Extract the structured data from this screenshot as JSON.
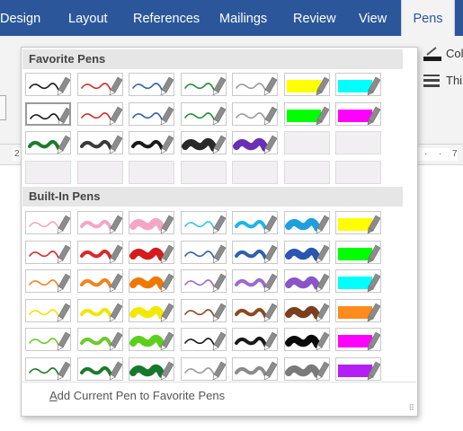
{
  "tabs": [
    {
      "label": "Design",
      "active": false
    },
    {
      "label": "Layout",
      "active": false
    },
    {
      "label": "References",
      "active": false
    },
    {
      "label": "Mailings",
      "active": false
    },
    {
      "label": "Review",
      "active": false
    },
    {
      "label": "View",
      "active": false
    },
    {
      "label": "Pens",
      "active": true
    }
  ],
  "ribbon": {
    "color_label": "Col",
    "thickness_label": "Thi"
  },
  "ruler": {
    "left_number": "2",
    "right_number": "7"
  },
  "gallery": {
    "favorite_header": "Favorite Pens",
    "builtin_header": "Built-In Pens",
    "add_link_prefix": "A",
    "add_link_rest": "dd Current Pen to Favorite Pens",
    "favorite_pens": [
      {
        "type": "pen",
        "color": "#1a1a1a",
        "width": 1.6
      },
      {
        "type": "pen",
        "color": "#d62b2b",
        "width": 1.6
      },
      {
        "type": "pen",
        "color": "#2f5fae",
        "width": 1.6
      },
      {
        "type": "pen",
        "color": "#238a3e",
        "width": 1.6
      },
      {
        "type": "pen",
        "color": "#9a9a9a",
        "width": 1.6
      },
      {
        "type": "highlighter",
        "color": "#ffff00"
      },
      {
        "type": "highlighter",
        "color": "#00ffff"
      },
      {
        "type": "pen",
        "color": "#1a1a1a",
        "width": 1.6,
        "selected": true
      },
      {
        "type": "pen",
        "color": "#d62b2b",
        "width": 1.6
      },
      {
        "type": "pen",
        "color": "#2f5fae",
        "width": 1.6
      },
      {
        "type": "pen",
        "color": "#238a3e",
        "width": 1.6
      },
      {
        "type": "pen",
        "color": "#9a9a9a",
        "width": 1.6
      },
      {
        "type": "highlighter",
        "color": "#00ff00"
      },
      {
        "type": "highlighter",
        "color": "#ff00ff"
      },
      {
        "type": "pen",
        "color": "#1e7a2e",
        "width": 4
      },
      {
        "type": "pen",
        "color": "#3a3a3a",
        "width": 4
      },
      {
        "type": "pen",
        "color": "#1a1a1a",
        "width": 4
      },
      {
        "type": "pen",
        "color": "#2a2a2a",
        "width": 8
      },
      {
        "type": "pen",
        "color": "#6b2fb3",
        "width": 8
      },
      {
        "type": "empty"
      },
      {
        "type": "empty"
      },
      {
        "type": "empty"
      },
      {
        "type": "empty"
      },
      {
        "type": "empty"
      },
      {
        "type": "empty"
      },
      {
        "type": "empty"
      },
      {
        "type": "empty"
      },
      {
        "type": "empty"
      }
    ],
    "builtin_pens": [
      {
        "type": "pen",
        "color": "#f4a7c4",
        "width": 1.6
      },
      {
        "type": "pen",
        "color": "#f4a7c4",
        "width": 4
      },
      {
        "type": "pen",
        "color": "#f4a7c4",
        "width": 8
      },
      {
        "type": "pen",
        "color": "#39c4e0",
        "width": 1.6
      },
      {
        "type": "pen",
        "color": "#1fb4ea",
        "width": 4
      },
      {
        "type": "pen",
        "color": "#1f9fe0",
        "width": 8
      },
      {
        "type": "highlighter",
        "color": "#ffff00"
      },
      {
        "type": "pen",
        "color": "#d62b2b",
        "width": 1.6
      },
      {
        "type": "pen",
        "color": "#d62b2b",
        "width": 4
      },
      {
        "type": "pen",
        "color": "#d41c1c",
        "width": 8
      },
      {
        "type": "pen",
        "color": "#2f5fae",
        "width": 1.6
      },
      {
        "type": "pen",
        "color": "#2f5fae",
        "width": 4
      },
      {
        "type": "pen",
        "color": "#2a56b0",
        "width": 8
      },
      {
        "type": "highlighter",
        "color": "#00ff00"
      },
      {
        "type": "pen",
        "color": "#f58220",
        "width": 1.6
      },
      {
        "type": "pen",
        "color": "#f58220",
        "width": 4
      },
      {
        "type": "pen",
        "color": "#f07800",
        "width": 8
      },
      {
        "type": "pen",
        "color": "#9d6ad0",
        "width": 1.6
      },
      {
        "type": "pen",
        "color": "#9d6ad0",
        "width": 4
      },
      {
        "type": "pen",
        "color": "#8a55c8",
        "width": 8
      },
      {
        "type": "highlighter",
        "color": "#00ffff"
      },
      {
        "type": "pen",
        "color": "#f2e500",
        "width": 1.6
      },
      {
        "type": "pen",
        "color": "#f2e500",
        "width": 4
      },
      {
        "type": "pen",
        "color": "#f2e800",
        "width": 8
      },
      {
        "type": "pen",
        "color": "#8b4a22",
        "width": 1.6
      },
      {
        "type": "pen",
        "color": "#8b4a22",
        "width": 4
      },
      {
        "type": "pen",
        "color": "#7a3f1e",
        "width": 8
      },
      {
        "type": "highlighter",
        "color": "#ff8a1e"
      },
      {
        "type": "pen",
        "color": "#6acb2a",
        "width": 1.6
      },
      {
        "type": "pen",
        "color": "#6acb2a",
        "width": 4
      },
      {
        "type": "pen",
        "color": "#5ccf1c",
        "width": 8
      },
      {
        "type": "pen",
        "color": "#1a1a1a",
        "width": 1.6
      },
      {
        "type": "pen",
        "color": "#1a1a1a",
        "width": 4
      },
      {
        "type": "pen",
        "color": "#0a0a0a",
        "width": 8
      },
      {
        "type": "highlighter",
        "color": "#ff00ff"
      },
      {
        "type": "pen",
        "color": "#1e7a2e",
        "width": 1.6
      },
      {
        "type": "pen",
        "color": "#1e7a2e",
        "width": 4
      },
      {
        "type": "pen",
        "color": "#16782c",
        "width": 8
      },
      {
        "type": "pen",
        "color": "#9a9a9a",
        "width": 1.6
      },
      {
        "type": "pen",
        "color": "#8a8a8a",
        "width": 4
      },
      {
        "type": "pen",
        "color": "#7a7a7a",
        "width": 8
      },
      {
        "type": "highlighter",
        "color": "#b31ff5"
      }
    ]
  }
}
